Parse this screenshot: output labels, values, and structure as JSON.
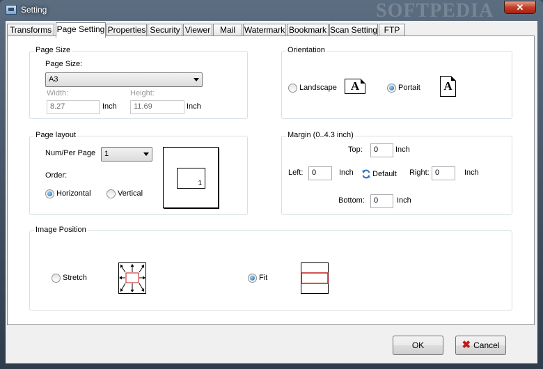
{
  "window": {
    "title": "Setting",
    "watermark": "SOFTPEDIA",
    "close_label": "✕"
  },
  "tabs": [
    {
      "label": "Transforms"
    },
    {
      "label": "Page Setting",
      "active": true
    },
    {
      "label": "Properties"
    },
    {
      "label": "Security"
    },
    {
      "label": "Viewer"
    },
    {
      "label": "Mail"
    },
    {
      "label": "Watermark"
    },
    {
      "label": "Bookmark"
    },
    {
      "label": "Scan Setting"
    },
    {
      "label": "FTP"
    }
  ],
  "page_size": {
    "group_title": "Page Size",
    "size_label": "Page Size:",
    "size_value": "A3",
    "width_label": "Width:",
    "width_value": "8.27",
    "width_unit": "Inch",
    "height_label": "Height:",
    "height_value": "11.69",
    "height_unit": "Inch"
  },
  "orientation": {
    "group_title": "Orientation",
    "landscape_label": "Landscape",
    "portrait_label": "Portait",
    "selected": "portrait",
    "icon_letter": "A"
  },
  "page_layout": {
    "group_title": "Page layout",
    "num_per_page_label": "Num/Per Page",
    "num_per_page_value": "1",
    "order_label": "Order:",
    "horizontal_label": "Horizontal",
    "vertical_label": "Vertical",
    "selected_order": "horizontal",
    "preview_number": "1"
  },
  "margin": {
    "group_title": "Margin (0..4.3 inch)",
    "top_label": "Top:",
    "top_value": "0",
    "left_label": "Left:",
    "left_value": "0",
    "right_label": "Right:",
    "right_value": "0",
    "bottom_label": "Bottom:",
    "bottom_value": "0",
    "unit": "Inch",
    "default_label": "Default"
  },
  "image_position": {
    "group_title": "Image Position",
    "stretch_label": "Stretch",
    "fit_label": "Fit",
    "selected": "fit"
  },
  "buttons": {
    "ok_label": "OK",
    "cancel_label": "Cancel"
  },
  "colors": {
    "accent_red": "#c01818",
    "radio_blue": "#1a5fa8"
  }
}
